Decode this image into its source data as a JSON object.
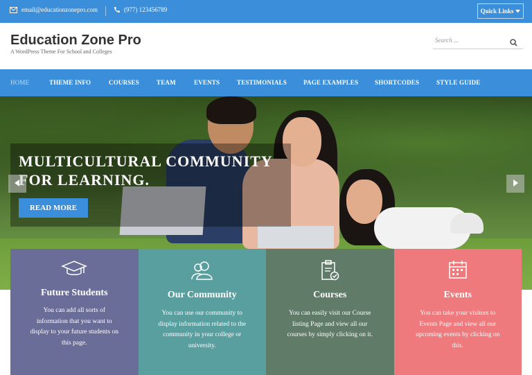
{
  "topbar": {
    "email": "email@educationzonepro.com",
    "phone": "(977) 123456789",
    "quick_links": "Quick Links"
  },
  "header": {
    "title": "Education Zone Pro",
    "tagline": "A WordPress Theme For School and Colleges",
    "search_placeholder": "Search ..."
  },
  "nav": {
    "items": [
      "HOME",
      "THEME INFO",
      "COURSES",
      "TEAM",
      "EVENTS",
      "TESTIMONIALS",
      "PAGE EXAMPLES",
      "SHORTCODES",
      "STYLE GUIDE"
    ],
    "active": "HOME"
  },
  "hero": {
    "title": "MULTICULTURAL COMMUNITY FOR LEARNING.",
    "button": "READ MORE"
  },
  "features": [
    {
      "title": "Future Students",
      "description": "You can add all sorts of information that you want to display to your future students on this page.",
      "color": "#6b6d99",
      "icon": "graduation-cap-icon"
    },
    {
      "title": "Our Community",
      "description": "You can use our community to display information related to the community in your college or university.",
      "color": "#5a9fa0",
      "icon": "community-icon"
    },
    {
      "title": "Courses",
      "description": "You can easily visit our Course listing Page and view all our courses by simply clicking on it.",
      "color": "#607c68",
      "icon": "clipboard-check-icon"
    },
    {
      "title": "Events",
      "description": "You can take your visitors to Events Page and view all our upcoming events by clicking on this.",
      "color": "#ee7a7d",
      "icon": "calendar-icon"
    }
  ],
  "colors": {
    "accent": "#3b8ed9"
  }
}
